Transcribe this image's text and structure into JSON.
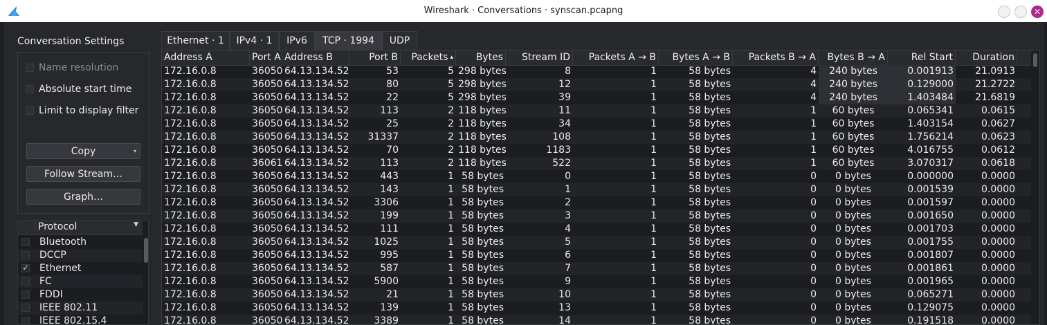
{
  "window": {
    "title": "Wireshark · Conversations · synscan.pcapng",
    "accent_color": "#b0278f"
  },
  "settings": {
    "title": "Conversation Settings",
    "options": [
      {
        "label": "Name resolution",
        "checked": false,
        "enabled": false
      },
      {
        "label": "Absolute start time",
        "checked": false,
        "enabled": true
      },
      {
        "label": "Limit to display filter",
        "checked": false,
        "enabled": true
      }
    ],
    "buttons": {
      "copy": "Copy",
      "follow": "Follow Stream…",
      "graph": "Graph…"
    }
  },
  "protocols": {
    "header": "Protocol",
    "items": [
      {
        "label": "Bluetooth",
        "checked": false
      },
      {
        "label": "DCCP",
        "checked": false
      },
      {
        "label": "Ethernet",
        "checked": true
      },
      {
        "label": "FC",
        "checked": false
      },
      {
        "label": "FDDI",
        "checked": false
      },
      {
        "label": "IEEE 802.11",
        "checked": false
      },
      {
        "label": "IEEE 802.15.4",
        "checked": false
      }
    ]
  },
  "tabs": [
    "Ethernet · 1",
    "IPv4 · 1",
    "IPv6",
    "TCP · 1994",
    "UDP"
  ],
  "active_tab": 3,
  "table": {
    "columns": [
      "Address A",
      "Port A",
      "Address B",
      "Port B",
      "Packets",
      "Bytes",
      "Stream ID",
      "Packets A → B",
      "Bytes A → B",
      "Packets B → A",
      "Bytes B → A",
      "Rel Start",
      "Duration"
    ],
    "sort_indicator": "▴",
    "rows": [
      [
        "172.16.0.8",
        "36050",
        "64.13.134.52",
        "53",
        "5",
        "298 bytes",
        "8",
        "1",
        "58 bytes",
        "4",
        "240 bytes",
        "0.001913",
        "21.0913"
      ],
      [
        "172.16.0.8",
        "36050",
        "64.13.134.52",
        "80",
        "5",
        "298 bytes",
        "12",
        "1",
        "58 bytes",
        "4",
        "240 bytes",
        "0.129000",
        "21.2722"
      ],
      [
        "172.16.0.8",
        "36050",
        "64.13.134.52",
        "22",
        "5",
        "298 bytes",
        "39",
        "1",
        "58 bytes",
        "4",
        "240 bytes",
        "1.403484",
        "21.6819"
      ],
      [
        "172.16.0.8",
        "36050",
        "64.13.134.52",
        "113",
        "2",
        "118 bytes",
        "11",
        "1",
        "58 bytes",
        "1",
        "60 bytes",
        "0.065341",
        "0.0615"
      ],
      [
        "172.16.0.8",
        "36050",
        "64.13.134.52",
        "25",
        "2",
        "118 bytes",
        "34",
        "1",
        "58 bytes",
        "1",
        "60 bytes",
        "1.403154",
        "0.0627"
      ],
      [
        "172.16.0.8",
        "36050",
        "64.13.134.52",
        "31337",
        "2",
        "118 bytes",
        "108",
        "1",
        "58 bytes",
        "1",
        "60 bytes",
        "1.756214",
        "0.0623"
      ],
      [
        "172.16.0.8",
        "36050",
        "64.13.134.52",
        "70",
        "2",
        "118 bytes",
        "1183",
        "1",
        "58 bytes",
        "1",
        "60 bytes",
        "4.016755",
        "0.0612"
      ],
      [
        "172.16.0.8",
        "36061",
        "64.13.134.52",
        "113",
        "2",
        "118 bytes",
        "522",
        "1",
        "58 bytes",
        "1",
        "60 bytes",
        "3.070317",
        "0.0618"
      ],
      [
        "172.16.0.8",
        "36050",
        "64.13.134.52",
        "443",
        "1",
        "58 bytes",
        "0",
        "1",
        "58 bytes",
        "0",
        "0 bytes",
        "0.000000",
        "0.0000"
      ],
      [
        "172.16.0.8",
        "36050",
        "64.13.134.52",
        "143",
        "1",
        "58 bytes",
        "1",
        "1",
        "58 bytes",
        "0",
        "0 bytes",
        "0.001539",
        "0.0000"
      ],
      [
        "172.16.0.8",
        "36050",
        "64.13.134.52",
        "3306",
        "1",
        "58 bytes",
        "2",
        "1",
        "58 bytes",
        "0",
        "0 bytes",
        "0.001597",
        "0.0000"
      ],
      [
        "172.16.0.8",
        "36050",
        "64.13.134.52",
        "199",
        "1",
        "58 bytes",
        "3",
        "1",
        "58 bytes",
        "0",
        "0 bytes",
        "0.001650",
        "0.0000"
      ],
      [
        "172.16.0.8",
        "36050",
        "64.13.134.52",
        "111",
        "1",
        "58 bytes",
        "4",
        "1",
        "58 bytes",
        "0",
        "0 bytes",
        "0.001703",
        "0.0000"
      ],
      [
        "172.16.0.8",
        "36050",
        "64.13.134.52",
        "1025",
        "1",
        "58 bytes",
        "5",
        "1",
        "58 bytes",
        "0",
        "0 bytes",
        "0.001755",
        "0.0000"
      ],
      [
        "172.16.0.8",
        "36050",
        "64.13.134.52",
        "995",
        "1",
        "58 bytes",
        "6",
        "1",
        "58 bytes",
        "0",
        "0 bytes",
        "0.001807",
        "0.0000"
      ],
      [
        "172.16.0.8",
        "36050",
        "64.13.134.52",
        "587",
        "1",
        "58 bytes",
        "7",
        "1",
        "58 bytes",
        "0",
        "0 bytes",
        "0.001861",
        "0.0000"
      ],
      [
        "172.16.0.8",
        "36050",
        "64.13.134.52",
        "5900",
        "1",
        "58 bytes",
        "9",
        "1",
        "58 bytes",
        "0",
        "0 bytes",
        "0.001965",
        "0.0000"
      ],
      [
        "172.16.0.8",
        "36050",
        "64.13.134.52",
        "21",
        "1",
        "58 bytes",
        "10",
        "1",
        "58 bytes",
        "0",
        "0 bytes",
        "0.065271",
        "0.0000"
      ],
      [
        "172.16.0.8",
        "36050",
        "64.13.134.52",
        "139",
        "1",
        "58 bytes",
        "13",
        "1",
        "58 bytes",
        "0",
        "0 bytes",
        "0.129075",
        "0.0000"
      ],
      [
        "172.16.0.8",
        "36050",
        "64.13.134.52",
        "3389",
        "1",
        "58 bytes",
        "14",
        "1",
        "58 bytes",
        "0",
        "0 bytes",
        "0.191518",
        "0.0000"
      ]
    ]
  }
}
